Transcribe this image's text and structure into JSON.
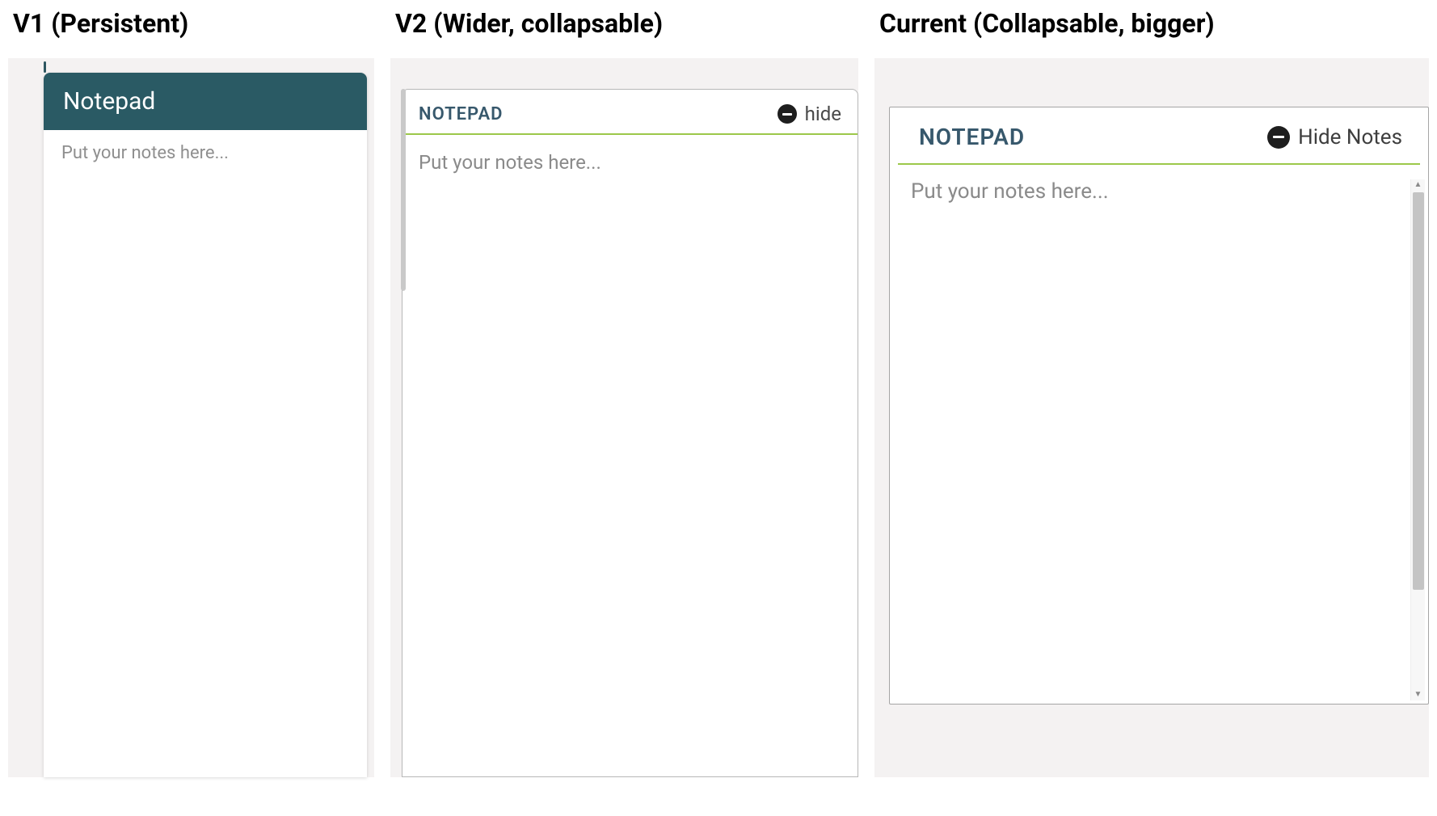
{
  "v1": {
    "caption": "V1 (Persistent)",
    "title": "Notepad",
    "placeholder": "Put your notes here..."
  },
  "v2": {
    "caption": "V2 (Wider, collapsable)",
    "title": "NOTEPAD",
    "hide_label": "hide",
    "placeholder": "Put your notes here..."
  },
  "current": {
    "caption": "Current (Collapsable, bigger)",
    "title": "NOTEPAD",
    "hide_label": "Hide Notes",
    "placeholder": "Put your notes here..."
  }
}
